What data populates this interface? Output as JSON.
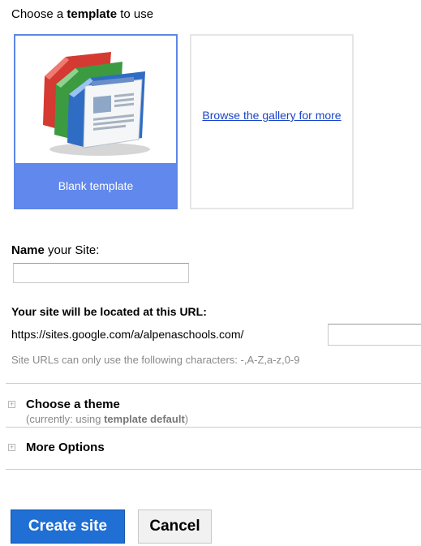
{
  "heading": {
    "prefix": "Choose a ",
    "bold": "template",
    "suffix": " to use"
  },
  "templates": {
    "blank_label": "Blank template",
    "gallery_link": "Browse the gallery for more"
  },
  "name_field": {
    "bold": "Name",
    "rest": " your Site:",
    "value": ""
  },
  "url": {
    "heading": "Your site will be located at this URL:",
    "prefix": "https://sites.google.com/a/alpenaschools.com/",
    "value": "",
    "note": "Site URLs can only use the following characters: -,A-Z,a-z,0-9"
  },
  "theme": {
    "title": "Choose a theme",
    "sub_prefix": "(currently: using ",
    "sub_bold": "template default",
    "sub_suffix": ")"
  },
  "more_options": {
    "title": "More Options"
  },
  "buttons": {
    "create": "Create site",
    "cancel": "Cancel"
  },
  "colors": {
    "accent": "#6188ec",
    "link": "#1a44c9",
    "create_button": "#1f6fd4"
  },
  "icons": {
    "template": "sites-template-icon",
    "expand": "expand-plus-icon"
  }
}
